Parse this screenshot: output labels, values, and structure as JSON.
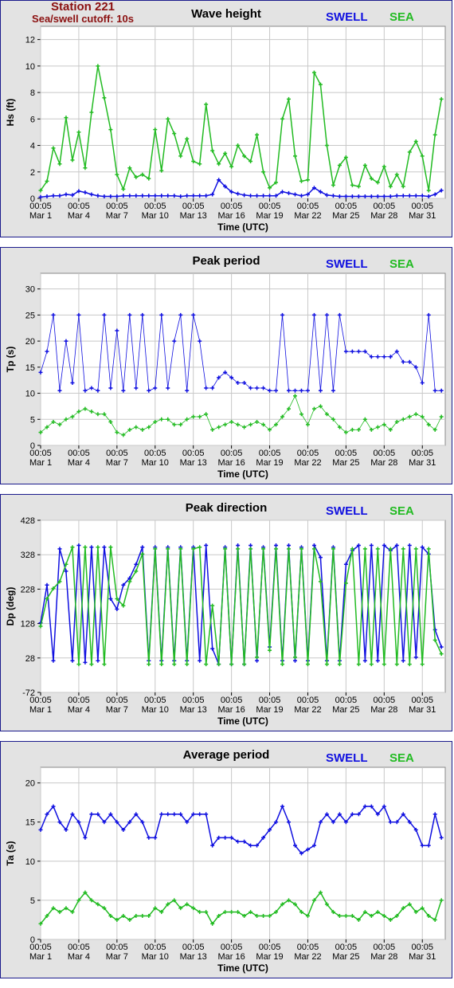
{
  "header": {
    "station": "Station 221",
    "cutoff": "Sea/swell cutoff: 10s"
  },
  "legend": {
    "swell": "SWELL",
    "sea": "SEA"
  },
  "colors": {
    "swell": "#1010e0",
    "sea": "#22bb22",
    "station": "#8b1010",
    "panel_bg": "#e3e3e3"
  },
  "xaxis": {
    "label": "Time (UTC)",
    "ticks": [
      {
        "time": "00:05",
        "date": "Mar 1"
      },
      {
        "time": "00:05",
        "date": "Mar 4"
      },
      {
        "time": "00:05",
        "date": "Mar 7"
      },
      {
        "time": "00:05",
        "date": "Mar 10"
      },
      {
        "time": "00:05",
        "date": "Mar 13"
      },
      {
        "time": "00:05",
        "date": "Mar 16"
      },
      {
        "time": "00:05",
        "date": "Mar 19"
      },
      {
        "time": "00:05",
        "date": "Mar 22"
      },
      {
        "time": "00:05",
        "date": "Mar 25"
      },
      {
        "time": "00:05",
        "date": "Mar 28"
      },
      {
        "time": "00:05",
        "date": "Mar 31"
      }
    ]
  },
  "chart_data": [
    {
      "type": "line",
      "title": "Wave height",
      "ylabel": "Hs (ft)",
      "ylim": [
        0,
        13
      ],
      "yticks": [
        0,
        2,
        4,
        6,
        8,
        10,
        12
      ],
      "x_day_range": [
        1,
        32.8
      ],
      "grid": true,
      "legend_position": "top-right",
      "x_days": [
        1,
        1.5,
        2,
        2.5,
        3,
        3.5,
        4,
        4.5,
        5,
        5.5,
        6,
        6.5,
        7,
        7.5,
        8,
        8.5,
        9,
        9.5,
        10,
        10.5,
        11,
        11.5,
        12,
        12.5,
        13,
        13.5,
        14,
        14.5,
        15,
        15.5,
        16,
        16.5,
        17,
        17.5,
        18,
        18.5,
        19,
        19.5,
        20,
        20.5,
        21,
        21.5,
        22,
        22.5,
        23,
        23.5,
        24,
        24.5,
        25,
        25.5,
        26,
        26.5,
        27,
        27.5,
        28,
        28.5,
        29,
        29.5,
        30,
        30.5,
        31,
        31.5,
        32,
        32.5
      ],
      "series": [
        {
          "name": "SWELL",
          "values": [
            0.1,
            0.15,
            0.2,
            0.2,
            0.3,
            0.25,
            0.55,
            0.45,
            0.3,
            0.2,
            0.15,
            0.15,
            0.15,
            0.2,
            0.2,
            0.2,
            0.2,
            0.2,
            0.2,
            0.2,
            0.2,
            0.2,
            0.15,
            0.2,
            0.2,
            0.2,
            0.2,
            0.3,
            1.4,
            0.9,
            0.5,
            0.35,
            0.25,
            0.2,
            0.2,
            0.2,
            0.2,
            0.2,
            0.5,
            0.4,
            0.3,
            0.2,
            0.3,
            0.8,
            0.5,
            0.25,
            0.2,
            0.15,
            0.15,
            0.15,
            0.15,
            0.15,
            0.15,
            0.15,
            0.15,
            0.15,
            0.2,
            0.2,
            0.2,
            0.2,
            0.2,
            0.15,
            0.3,
            0.6
          ]
        },
        {
          "name": "SEA",
          "values": [
            0.6,
            1.3,
            3.8,
            2.6,
            6.1,
            2.9,
            5.0,
            2.3,
            6.5,
            10.0,
            7.6,
            5.2,
            1.8,
            0.7,
            2.3,
            1.6,
            1.8,
            1.5,
            5.2,
            2.1,
            6.0,
            4.9,
            3.2,
            4.5,
            2.8,
            2.6,
            7.1,
            3.6,
            2.6,
            3.4,
            2.4,
            4.0,
            3.2,
            2.8,
            4.8,
            2.0,
            0.8,
            1.2,
            6.0,
            7.5,
            3.2,
            1.3,
            1.4,
            9.5,
            8.6,
            4.0,
            1.0,
            2.5,
            3.1,
            1.0,
            0.9,
            2.5,
            1.5,
            1.2,
            2.4,
            0.9,
            1.8,
            0.9,
            3.5,
            4.3,
            3.2,
            0.6,
            4.8,
            7.5
          ]
        }
      ]
    },
    {
      "type": "scatter",
      "title": "Peak period",
      "ylabel": "Tp (s)",
      "ylim": [
        0,
        33
      ],
      "yticks": [
        0,
        5,
        10,
        15,
        20,
        25,
        30
      ],
      "x_day_range": [
        1,
        32.8
      ],
      "grid": true,
      "legend_position": "top-right",
      "x_days": [
        1,
        1.5,
        2,
        2.5,
        3,
        3.5,
        4,
        4.5,
        5,
        5.5,
        6,
        6.5,
        7,
        7.5,
        8,
        8.5,
        9,
        9.5,
        10,
        10.5,
        11,
        11.5,
        12,
        12.5,
        13,
        13.5,
        14,
        14.5,
        15,
        15.5,
        16,
        16.5,
        17,
        17.5,
        18,
        18.5,
        19,
        19.5,
        20,
        20.5,
        21,
        21.5,
        22,
        22.5,
        23,
        23.5,
        24,
        24.5,
        25,
        25.5,
        26,
        26.5,
        27,
        27.5,
        28,
        28.5,
        29,
        29.5,
        30,
        30.5,
        31,
        31.5,
        32,
        32.5
      ],
      "series": [
        {
          "name": "SWELL",
          "values": [
            14,
            18,
            25,
            10.5,
            20,
            12,
            25,
            10.5,
            11,
            10.5,
            25,
            11,
            22,
            10.5,
            25,
            11,
            25,
            10.5,
            11,
            25,
            11,
            20,
            25,
            10.5,
            25,
            20,
            11,
            11,
            13,
            14,
            13,
            12,
            12,
            11,
            11,
            11,
            10.5,
            10.5,
            25,
            10.5,
            10.5,
            10.5,
            10.5,
            25,
            10.5,
            25,
            10.5,
            25,
            18,
            18,
            18,
            18,
            17,
            17,
            17,
            17,
            18,
            16,
            16,
            15,
            12,
            25,
            10.5,
            10.5
          ]
        },
        {
          "name": "SEA",
          "values": [
            2.5,
            3.5,
            4.5,
            4,
            5,
            5.5,
            6.5,
            7,
            6.5,
            6,
            6,
            4.5,
            2.5,
            2,
            3,
            3.5,
            3,
            3.5,
            4.5,
            5,
            5,
            4,
            4,
            5,
            5.5,
            5.5,
            6,
            3,
            3.5,
            4,
            4.5,
            4,
            3.5,
            4,
            4.5,
            4,
            3,
            4,
            5.5,
            7,
            9.5,
            6,
            4,
            7,
            7.5,
            6,
            5,
            3.5,
            2.5,
            3,
            3,
            5,
            3,
            3.5,
            4,
            3,
            4.5,
            5,
            5.5,
            6,
            5.5,
            4,
            3,
            5.5
          ]
        }
      ]
    },
    {
      "type": "line",
      "title": "Peak direction",
      "ylabel": "Dp (deg)",
      "ylim": [
        -72,
        428
      ],
      "yticks": [
        -72,
        28,
        128,
        228,
        328,
        428
      ],
      "x_day_range": [
        1,
        32.8
      ],
      "grid": true,
      "legend_position": "top-right",
      "x_days": [
        1,
        1.5,
        2,
        2.5,
        3,
        3.5,
        4,
        4.5,
        5,
        5.5,
        6,
        6.5,
        7,
        7.5,
        8,
        8.5,
        9,
        9.5,
        10,
        10.5,
        11,
        11.5,
        12,
        12.5,
        13,
        13.5,
        14,
        14.5,
        15,
        15.5,
        16,
        16.5,
        17,
        17.5,
        18,
        18.5,
        19,
        19.5,
        20,
        20.5,
        21,
        21.5,
        22,
        22.5,
        23,
        23.5,
        24,
        24.5,
        25,
        25.5,
        26,
        26.5,
        27,
        27.5,
        28,
        28.5,
        29,
        29.5,
        30,
        30.5,
        31,
        31.5,
        32,
        32.5
      ],
      "series": [
        {
          "name": "SWELL",
          "values": [
            130,
            240,
            20,
            345,
            280,
            20,
            355,
            15,
            350,
            20,
            350,
            200,
            170,
            240,
            260,
            300,
            350,
            20,
            350,
            20,
            350,
            20,
            350,
            20,
            350,
            20,
            355,
            55,
            10,
            350,
            10,
            355,
            10,
            355,
            20,
            350,
            60,
            355,
            20,
            355,
            20,
            350,
            20,
            355,
            320,
            20,
            350,
            20,
            300,
            340,
            355,
            20,
            355,
            20,
            355,
            340,
            355,
            20,
            355,
            30,
            350,
            330,
            110,
            60
          ]
        },
        {
          "name": "SEA",
          "values": [
            120,
            200,
            230,
            250,
            300,
            350,
            10,
            350,
            10,
            350,
            10,
            350,
            200,
            180,
            250,
            280,
            330,
            10,
            345,
            10,
            345,
            10,
            345,
            10,
            345,
            350,
            10,
            180,
            10,
            345,
            10,
            345,
            10,
            345,
            30,
            345,
            50,
            345,
            10,
            345,
            30,
            345,
            10,
            345,
            250,
            10,
            345,
            10,
            245,
            345,
            10,
            345,
            10,
            345,
            10,
            345,
            10,
            345,
            10,
            345,
            10,
            345,
            80,
            40
          ]
        }
      ]
    },
    {
      "type": "line",
      "title": "Average period",
      "ylabel": "Ta (s)",
      "ylim": [
        0,
        22
      ],
      "yticks": [
        0,
        5,
        10,
        15,
        20
      ],
      "x_day_range": [
        1,
        32.8
      ],
      "grid": true,
      "legend_position": "top-right",
      "x_days": [
        1,
        1.5,
        2,
        2.5,
        3,
        3.5,
        4,
        4.5,
        5,
        5.5,
        6,
        6.5,
        7,
        7.5,
        8,
        8.5,
        9,
        9.5,
        10,
        10.5,
        11,
        11.5,
        12,
        12.5,
        13,
        13.5,
        14,
        14.5,
        15,
        15.5,
        16,
        16.5,
        17,
        17.5,
        18,
        18.5,
        19,
        19.5,
        20,
        20.5,
        21,
        21.5,
        22,
        22.5,
        23,
        23.5,
        24,
        24.5,
        25,
        25.5,
        26,
        26.5,
        27,
        27.5,
        28,
        28.5,
        29,
        29.5,
        30,
        30.5,
        31,
        31.5,
        32,
        32.5
      ],
      "series": [
        {
          "name": "SWELL",
          "values": [
            14,
            16,
            17,
            15,
            14,
            16,
            15,
            13,
            16,
            16,
            15,
            16,
            15,
            14,
            15,
            16,
            15,
            13,
            13,
            16,
            16,
            16,
            16,
            15,
            16,
            16,
            16,
            12,
            13,
            13,
            13,
            12.5,
            12.5,
            12,
            12,
            13,
            14,
            15,
            17,
            15,
            12,
            11,
            11.5,
            12,
            15,
            16,
            15,
            16,
            15,
            16,
            16,
            17,
            17,
            16,
            17,
            15,
            15,
            16,
            15,
            14,
            12,
            12,
            16,
            13
          ]
        },
        {
          "name": "SEA",
          "values": [
            2,
            3,
            4,
            3.5,
            4,
            3.5,
            5,
            6,
            5,
            4.5,
            4,
            3,
            2.5,
            3,
            2.5,
            3,
            3,
            3,
            4,
            3.5,
            4.5,
            5,
            4,
            4.5,
            4,
            3.5,
            3.5,
            2,
            3,
            3.5,
            3.5,
            3.5,
            3,
            3.5,
            3,
            3,
            3,
            3.5,
            4.5,
            5,
            4.5,
            3.5,
            3,
            5,
            6,
            4.5,
            3.5,
            3,
            3,
            3,
            2.5,
            3.5,
            3,
            3.5,
            3,
            2.5,
            3,
            4,
            4.5,
            3.5,
            4,
            3,
            2.5,
            5
          ]
        }
      ]
    }
  ]
}
